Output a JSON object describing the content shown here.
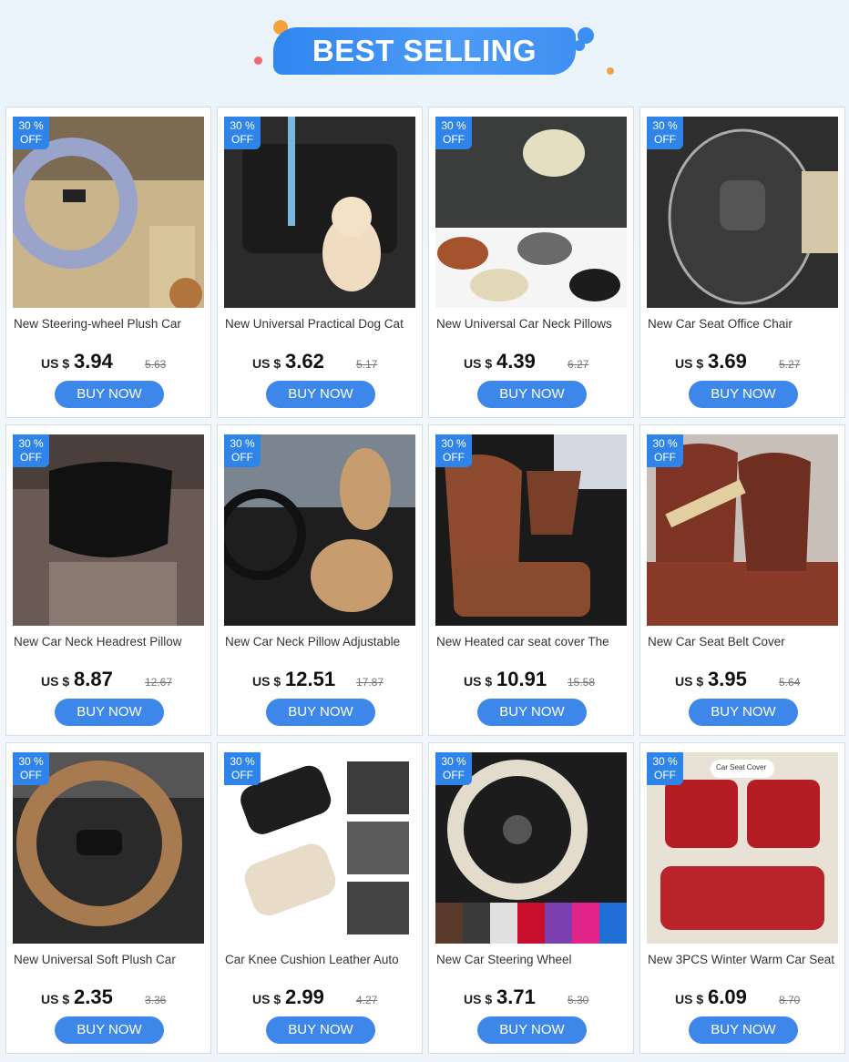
{
  "header": {
    "title": "BEST SELLING"
  },
  "colors": {
    "accent": "#3d86ea",
    "badge": "#2f84ea"
  },
  "products": [
    {
      "badge_pct": "30 %",
      "badge_off": "OFF",
      "title": "New Steering-wheel Plush Car",
      "currency": "US $",
      "price": "3.94",
      "old_price": "5.63",
      "buy": "BUY NOW",
      "icon": "steering-wheel-cover-image"
    },
    {
      "badge_pct": "30 %",
      "badge_off": "OFF",
      "title": "New Universal Practical Dog Cat",
      "currency": "US $",
      "price": "3.62",
      "old_price": "5.17",
      "buy": "BUY NOW",
      "icon": "dog-seat-belt-image"
    },
    {
      "badge_pct": "30 %",
      "badge_off": "OFF",
      "title": "New Universal Car Neck Pillows",
      "currency": "US $",
      "price": "4.39",
      "old_price": "6.27",
      "buy": "BUY NOW",
      "icon": "neck-pillow-image"
    },
    {
      "badge_pct": "30 %",
      "badge_off": "OFF",
      "title": "New Car Seat Office Chair",
      "currency": "US $",
      "price": "3.69",
      "old_price": "5.27",
      "buy": "BUY NOW",
      "icon": "lumbar-support-image"
    },
    {
      "badge_pct": "30 %",
      "badge_off": "OFF",
      "title": "New Car Neck Headrest Pillow",
      "currency": "US $",
      "price": "8.87",
      "old_price": "12.67",
      "buy": "BUY NOW",
      "icon": "headrest-pillow-image"
    },
    {
      "badge_pct": "30 %",
      "badge_off": "OFF",
      "title": "New Car Neck Pillow Adjustable",
      "currency": "US $",
      "price": "12.51",
      "old_price": "17.87",
      "buy": "BUY NOW",
      "icon": "neck-back-pillow-image"
    },
    {
      "badge_pct": "30 %",
      "badge_off": "OFF",
      "title": "New Heated car seat cover  The",
      "currency": "US $",
      "price": "10.91",
      "old_price": "15.58",
      "buy": "BUY NOW",
      "icon": "heated-seat-cover-image"
    },
    {
      "badge_pct": "30 %",
      "badge_off": "OFF",
      "title": "New Car Seat Belt Cover",
      "currency": "US $",
      "price": "3.95",
      "old_price": "5.64",
      "buy": "BUY NOW",
      "icon": "seat-belt-cover-image"
    },
    {
      "badge_pct": "30 %",
      "badge_off": "OFF",
      "title": "New Universal Soft Plush Car",
      "currency": "US $",
      "price": "2.35",
      "old_price": "3.36",
      "buy": "BUY NOW",
      "icon": "plush-wheel-cover-image"
    },
    {
      "badge_pct": "30 %",
      "badge_off": "OFF",
      "title": "Car Knee Cushion Leather Auto",
      "currency": "US $",
      "price": "2.99",
      "old_price": "4.27",
      "buy": "BUY NOW",
      "icon": "knee-cushion-image"
    },
    {
      "badge_pct": "30 %",
      "badge_off": "OFF",
      "title": "New Car Steering Wheel",
      "currency": "US $",
      "price": "3.71",
      "old_price": "5.30",
      "buy": "BUY NOW",
      "icon": "mesh-wheel-cover-image"
    },
    {
      "badge_pct": "30 %",
      "badge_off": "OFF",
      "title": "New 3PCS Winter Warm Car Seat",
      "currency": "US $",
      "price": "6.09",
      "old_price": "8.70",
      "buy": "BUY NOW",
      "icon": "seat-cushion-set-image",
      "photo_caption": "Car Seat Cover"
    }
  ]
}
